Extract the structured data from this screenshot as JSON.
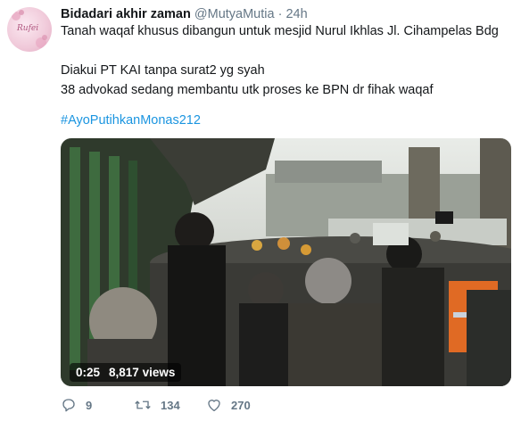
{
  "tweet": {
    "display_name": "Bidadari akhir zaman",
    "handle": "@MutyaMutia",
    "separator": "·",
    "time": "24h",
    "avatar_text": "Rufei",
    "lines": [
      "Tanah waqaf khusus dibangun untuk mesjid Nurul Ikhlas Jl. Cihampelas Bdg",
      "Diakui PT KAI tanpa surat2 yg syah",
      "38 advokad sedang membantu utk proses ke BPN dr fihak waqaf"
    ],
    "hashtag": "#AyoPutihkanMonas212"
  },
  "video": {
    "duration": "0:25",
    "views": "8,817 views"
  },
  "actions": {
    "replies": "9",
    "retweets": "134",
    "likes": "270"
  },
  "colors": {
    "link": "#1b95e0",
    "secondary_text": "#657786"
  }
}
